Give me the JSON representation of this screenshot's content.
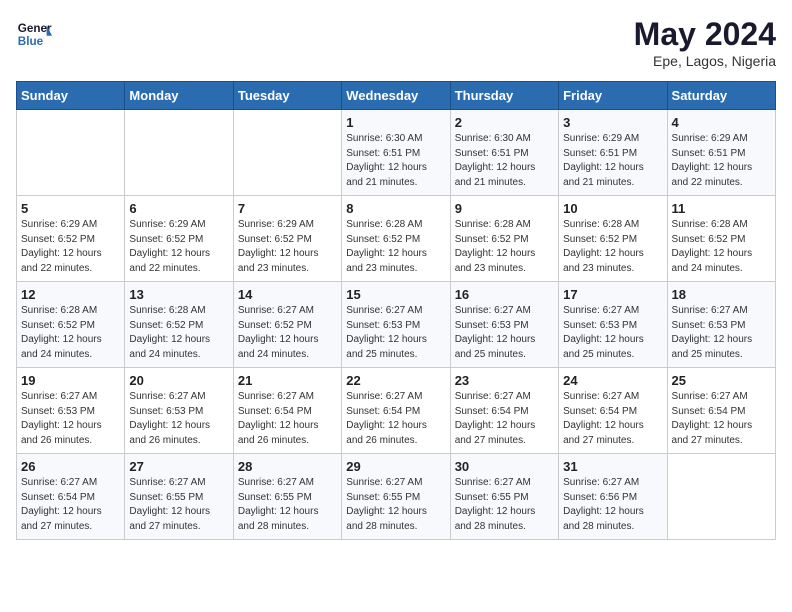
{
  "logo": {
    "line1": "General",
    "line2": "Blue"
  },
  "title": "May 2024",
  "subtitle": "Epe, Lagos, Nigeria",
  "days_of_week": [
    "Sunday",
    "Monday",
    "Tuesday",
    "Wednesday",
    "Thursday",
    "Friday",
    "Saturday"
  ],
  "weeks": [
    [
      {
        "day": "",
        "info": ""
      },
      {
        "day": "",
        "info": ""
      },
      {
        "day": "",
        "info": ""
      },
      {
        "day": "1",
        "info": "Sunrise: 6:30 AM\nSunset: 6:51 PM\nDaylight: 12 hours\nand 21 minutes."
      },
      {
        "day": "2",
        "info": "Sunrise: 6:30 AM\nSunset: 6:51 PM\nDaylight: 12 hours\nand 21 minutes."
      },
      {
        "day": "3",
        "info": "Sunrise: 6:29 AM\nSunset: 6:51 PM\nDaylight: 12 hours\nand 21 minutes."
      },
      {
        "day": "4",
        "info": "Sunrise: 6:29 AM\nSunset: 6:51 PM\nDaylight: 12 hours\nand 22 minutes."
      }
    ],
    [
      {
        "day": "5",
        "info": "Sunrise: 6:29 AM\nSunset: 6:52 PM\nDaylight: 12 hours\nand 22 minutes."
      },
      {
        "day": "6",
        "info": "Sunrise: 6:29 AM\nSunset: 6:52 PM\nDaylight: 12 hours\nand 22 minutes."
      },
      {
        "day": "7",
        "info": "Sunrise: 6:29 AM\nSunset: 6:52 PM\nDaylight: 12 hours\nand 23 minutes."
      },
      {
        "day": "8",
        "info": "Sunrise: 6:28 AM\nSunset: 6:52 PM\nDaylight: 12 hours\nand 23 minutes."
      },
      {
        "day": "9",
        "info": "Sunrise: 6:28 AM\nSunset: 6:52 PM\nDaylight: 12 hours\nand 23 minutes."
      },
      {
        "day": "10",
        "info": "Sunrise: 6:28 AM\nSunset: 6:52 PM\nDaylight: 12 hours\nand 23 minutes."
      },
      {
        "day": "11",
        "info": "Sunrise: 6:28 AM\nSunset: 6:52 PM\nDaylight: 12 hours\nand 24 minutes."
      }
    ],
    [
      {
        "day": "12",
        "info": "Sunrise: 6:28 AM\nSunset: 6:52 PM\nDaylight: 12 hours\nand 24 minutes."
      },
      {
        "day": "13",
        "info": "Sunrise: 6:28 AM\nSunset: 6:52 PM\nDaylight: 12 hours\nand 24 minutes."
      },
      {
        "day": "14",
        "info": "Sunrise: 6:27 AM\nSunset: 6:52 PM\nDaylight: 12 hours\nand 24 minutes."
      },
      {
        "day": "15",
        "info": "Sunrise: 6:27 AM\nSunset: 6:53 PM\nDaylight: 12 hours\nand 25 minutes."
      },
      {
        "day": "16",
        "info": "Sunrise: 6:27 AM\nSunset: 6:53 PM\nDaylight: 12 hours\nand 25 minutes."
      },
      {
        "day": "17",
        "info": "Sunrise: 6:27 AM\nSunset: 6:53 PM\nDaylight: 12 hours\nand 25 minutes."
      },
      {
        "day": "18",
        "info": "Sunrise: 6:27 AM\nSunset: 6:53 PM\nDaylight: 12 hours\nand 25 minutes."
      }
    ],
    [
      {
        "day": "19",
        "info": "Sunrise: 6:27 AM\nSunset: 6:53 PM\nDaylight: 12 hours\nand 26 minutes."
      },
      {
        "day": "20",
        "info": "Sunrise: 6:27 AM\nSunset: 6:53 PM\nDaylight: 12 hours\nand 26 minutes."
      },
      {
        "day": "21",
        "info": "Sunrise: 6:27 AM\nSunset: 6:54 PM\nDaylight: 12 hours\nand 26 minutes."
      },
      {
        "day": "22",
        "info": "Sunrise: 6:27 AM\nSunset: 6:54 PM\nDaylight: 12 hours\nand 26 minutes."
      },
      {
        "day": "23",
        "info": "Sunrise: 6:27 AM\nSunset: 6:54 PM\nDaylight: 12 hours\nand 27 minutes."
      },
      {
        "day": "24",
        "info": "Sunrise: 6:27 AM\nSunset: 6:54 PM\nDaylight: 12 hours\nand 27 minutes."
      },
      {
        "day": "25",
        "info": "Sunrise: 6:27 AM\nSunset: 6:54 PM\nDaylight: 12 hours\nand 27 minutes."
      }
    ],
    [
      {
        "day": "26",
        "info": "Sunrise: 6:27 AM\nSunset: 6:54 PM\nDaylight: 12 hours\nand 27 minutes."
      },
      {
        "day": "27",
        "info": "Sunrise: 6:27 AM\nSunset: 6:55 PM\nDaylight: 12 hours\nand 27 minutes."
      },
      {
        "day": "28",
        "info": "Sunrise: 6:27 AM\nSunset: 6:55 PM\nDaylight: 12 hours\nand 28 minutes."
      },
      {
        "day": "29",
        "info": "Sunrise: 6:27 AM\nSunset: 6:55 PM\nDaylight: 12 hours\nand 28 minutes."
      },
      {
        "day": "30",
        "info": "Sunrise: 6:27 AM\nSunset: 6:55 PM\nDaylight: 12 hours\nand 28 minutes."
      },
      {
        "day": "31",
        "info": "Sunrise: 6:27 AM\nSunset: 6:56 PM\nDaylight: 12 hours\nand 28 minutes."
      },
      {
        "day": "",
        "info": ""
      }
    ]
  ]
}
